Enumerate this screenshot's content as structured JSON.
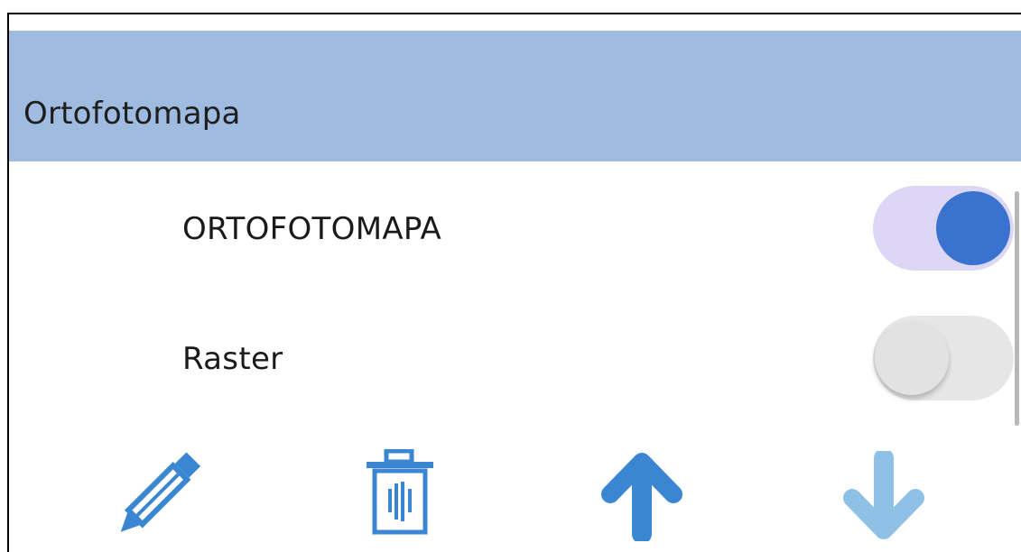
{
  "group": {
    "title": "Ortofotomapa"
  },
  "layers": [
    {
      "label": "ORTOFOTOMAPA",
      "enabled": true
    },
    {
      "label": "Raster",
      "enabled": false
    }
  ],
  "toolbar": {
    "actions": [
      {
        "name": "edit",
        "icon": "pencil-icon",
        "color": "#3a86d3"
      },
      {
        "name": "delete",
        "icon": "trash-icon",
        "color": "#3a86d3"
      },
      {
        "name": "move-up",
        "icon": "arrow-up-icon",
        "color": "#3a86d3"
      },
      {
        "name": "move-down",
        "icon": "arrow-down-icon",
        "color": "#8fc1e7"
      }
    ]
  },
  "colors": {
    "header_bg": "#9fbbe0",
    "toggle_on_track": "#ddd6f5",
    "toggle_on_knob": "#3a72cf",
    "toggle_off_track": "#e6e6e6"
  }
}
